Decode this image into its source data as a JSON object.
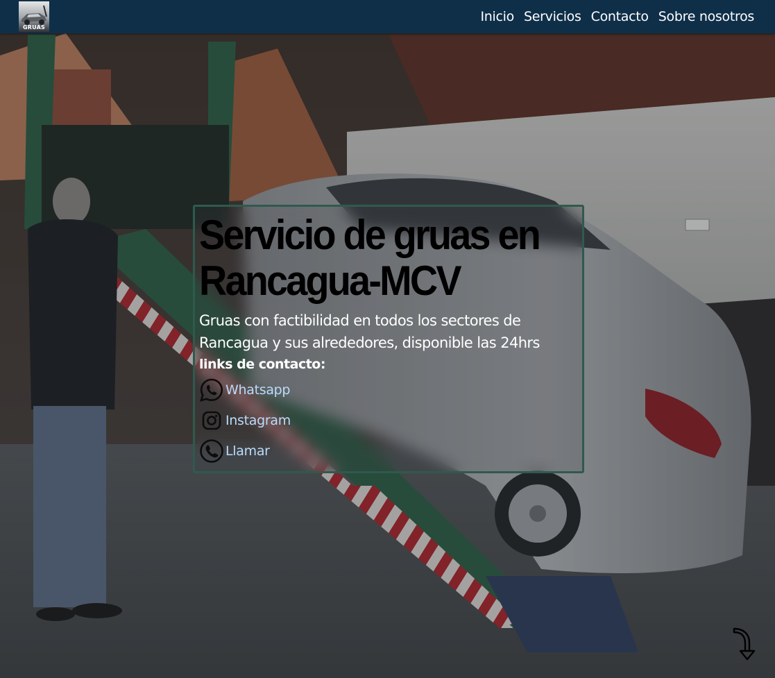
{
  "navbar": {
    "logo_text": "GRUAS",
    "links": [
      {
        "label": "Inicio"
      },
      {
        "label": "Servicios"
      },
      {
        "label": "Contacto"
      },
      {
        "label": "Sobre nosotros"
      }
    ]
  },
  "hero": {
    "title_line1": "Servicio de gruas en",
    "title_line2": "Rancagua-MCV",
    "description": "Gruas con factibilidad en todos los sectores de Rancagua y sus alrededores, disponible las 24hrs",
    "contact_heading": "links de contacto:",
    "contacts": [
      {
        "label": "Whatsapp",
        "icon": "whatsapp-icon"
      },
      {
        "label": "Instagram",
        "icon": "instagram-icon"
      },
      {
        "label": "Llamar",
        "icon": "phone-icon"
      }
    ]
  },
  "colors": {
    "navbar_bg": "#0f2f49",
    "card_border": "#2f5a4e",
    "link_color": "#b9dcfb",
    "title_color": "#000000"
  },
  "scroll_indicator": {
    "icon": "curved-arrow-down-icon"
  }
}
